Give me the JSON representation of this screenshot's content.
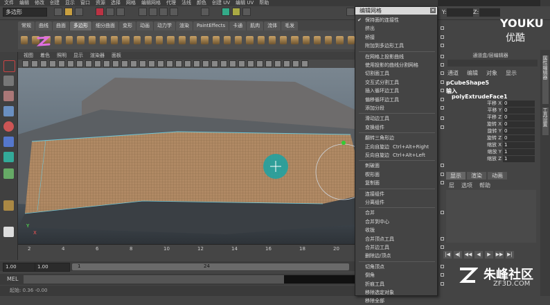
{
  "menubar": {
    "items": [
      "文件",
      "编辑",
      "修改",
      "创建",
      "显示",
      "窗口",
      "资源",
      "选择",
      "网格",
      "编辑网格",
      "代理",
      "法线",
      "颜色",
      "创建 UV",
      "编辑 UV",
      "帮助"
    ]
  },
  "status": {
    "mode": "多边形",
    "y_label": "Y:",
    "z_label": "Z:"
  },
  "shelf": {
    "tabs": [
      "常规",
      "曲线",
      "曲面",
      "多边形",
      "细分曲面",
      "变形",
      "动画",
      "动力学",
      "渲染",
      "PaintEffects",
      "卡通",
      "肌肉",
      "流体",
      "毛发"
    ],
    "active_tab": "多边形"
  },
  "viewport": {
    "menu": [
      "视图",
      "着色",
      "照明",
      "显示",
      "渲染器",
      "面板"
    ],
    "axis_x": "X",
    "axis_y": "Y"
  },
  "timeline": {
    "ticks": [
      "2",
      "4",
      "6",
      "8",
      "10",
      "12",
      "14",
      "16",
      "18",
      "20"
    ],
    "range_start": "1.00",
    "range_inner": "1.00",
    "slider_start": "1",
    "slider_end": "24"
  },
  "mel": {
    "label": "MEL",
    "help_text": "起始: 0.36    -0.00"
  },
  "popup": {
    "title": "编辑网格",
    "items": [
      {
        "label": "保持面的连接性",
        "checked": true
      },
      {
        "label": "挤出",
        "opt": true
      },
      {
        "label": "桥接",
        "opt": true
      },
      {
        "label": "附加到多边形工具",
        "opt": true
      },
      {
        "label": "在网格上投影曲线",
        "opt": true
      },
      {
        "label": "使用投影的曲线分割网格",
        "opt": true
      },
      {
        "label": "切割面工具",
        "opt": true
      },
      {
        "label": "交互式分割工具",
        "opt": true
      },
      {
        "label": "插入循环边工具",
        "opt": true
      },
      {
        "label": "偏移循环边工具",
        "opt": true
      },
      {
        "label": "添加分段",
        "opt": true
      },
      {
        "label": "滑动边工具",
        "opt": true
      },
      {
        "label": "变换组件",
        "opt": true
      },
      {
        "label": "翻转三角形边",
        "opt": false
      },
      {
        "label": "正向自旋边",
        "shortcut": "Ctrl+Alt+Right"
      },
      {
        "label": "反向自旋边",
        "shortcut": "Ctrl+Alt+Left"
      },
      {
        "label": "刺破面",
        "opt": true
      },
      {
        "label": "楔形面",
        "opt": true
      },
      {
        "label": "复制面",
        "opt": true
      },
      {
        "label": "连接组件",
        "opt": false
      },
      {
        "label": "分离组件",
        "opt": false
      },
      {
        "label": "合并",
        "opt": true
      },
      {
        "label": "合并到中心",
        "opt": false
      },
      {
        "label": "收拢",
        "opt": false
      },
      {
        "label": "合并顶点工具",
        "opt": true
      },
      {
        "label": "合并边工具",
        "opt": true
      },
      {
        "label": "删除边/顶点",
        "opt": false
      },
      {
        "label": "切角顶点",
        "opt": true
      },
      {
        "label": "倒角",
        "opt": true
      },
      {
        "label": "折痕工具",
        "opt": true
      },
      {
        "label": "移除选定对象",
        "opt": false
      },
      {
        "label": "移除全部",
        "opt": false
      }
    ]
  },
  "channel_box": {
    "title": "通道盒/层编辑器",
    "menu": [
      "通道",
      "编辑",
      "对象",
      "显示"
    ],
    "object": "pCubeShape5",
    "input_label": "输入",
    "node": "polyExtrudeFace1",
    "attributes": [
      {
        "name": "平移 X",
        "value": "0"
      },
      {
        "name": "平移 Y",
        "value": "0"
      },
      {
        "name": "平移 Z",
        "value": "0"
      },
      {
        "name": "旋转 X",
        "value": "0"
      },
      {
        "name": "旋转 Y",
        "value": "0"
      },
      {
        "name": "旋转 Z",
        "value": "0"
      },
      {
        "name": "缩放 X",
        "value": "1"
      },
      {
        "name": "缩放 Y",
        "value": "1"
      },
      {
        "name": "缩放 Z",
        "value": "1"
      }
    ],
    "layer_tabs": [
      "显示",
      "渲染",
      "动画"
    ],
    "layer_menu": [
      "层",
      "选项",
      "帮助"
    ]
  },
  "side_tabs": [
    "属性编辑器",
    "工具设置"
  ],
  "watermarks": {
    "youku": "YOUKU",
    "youku_cn": "优酷",
    "zf": "朱峰社区",
    "zf_sub": "ZF3D.COM"
  },
  "colors": {
    "accent": "#c8a060",
    "viewport_top": "#7a8690",
    "mesh": "#c89060"
  }
}
